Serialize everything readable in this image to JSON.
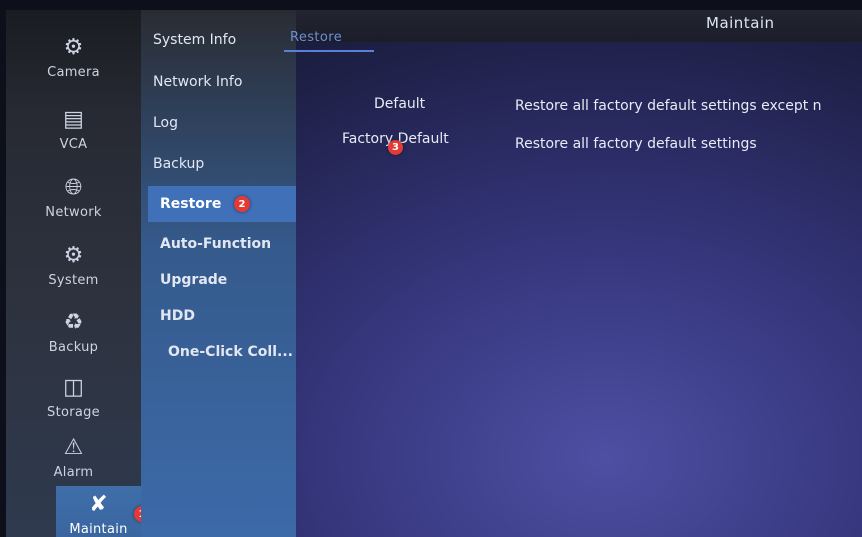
{
  "header": {
    "title": "Maintain"
  },
  "rail": [
    {
      "label": "Camera",
      "icon": "camera-icon"
    },
    {
      "label": "VCA",
      "icon": "vca-icon"
    },
    {
      "label": "Network",
      "icon": "network-icon"
    },
    {
      "label": "System",
      "icon": "gear-icon"
    },
    {
      "label": "Backup",
      "icon": "backup-icon"
    },
    {
      "label": "Storage",
      "icon": "storage-icon"
    },
    {
      "label": "Alarm",
      "icon": "alarm-icon"
    },
    {
      "label": "Maintain",
      "icon": "wrench-icon",
      "active": true
    }
  ],
  "submenu": [
    {
      "label": "System Info"
    },
    {
      "label": "Network Info"
    },
    {
      "label": "Log"
    },
    {
      "label": "Backup"
    },
    {
      "label": "Restore",
      "active": true
    },
    {
      "label": "Auto-Function"
    },
    {
      "label": "Upgrade"
    },
    {
      "label": "HDD"
    },
    {
      "label": "One-Click Coll..."
    }
  ],
  "tabs": {
    "active": "Restore"
  },
  "restore": [
    {
      "name": "Default",
      "description": "Restore all factory default settings except n"
    },
    {
      "name": "Factory Default",
      "description": "Restore all factory default settings"
    }
  ],
  "annotations": {
    "step1": "1",
    "step2": "2",
    "step3": "3"
  },
  "colors": {
    "accent": "#3f70b8",
    "badge": "#e53935",
    "tab": "#6d8fd6"
  }
}
